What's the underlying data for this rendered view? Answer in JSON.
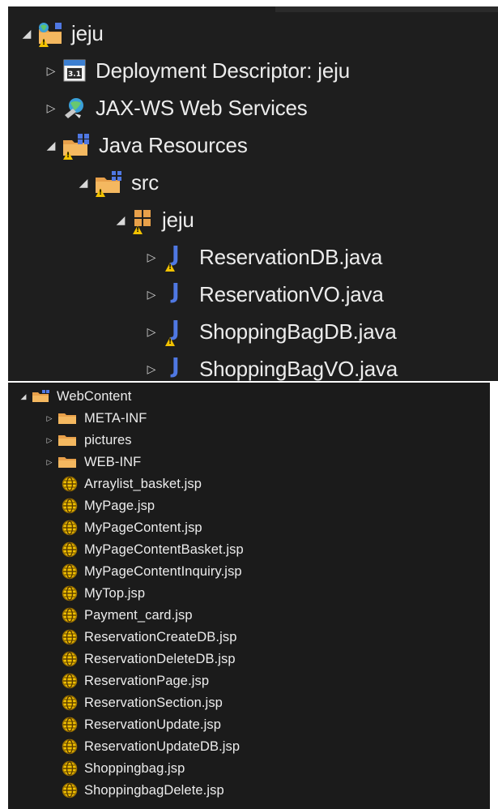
{
  "colors": {
    "background": "#1e1e1e",
    "text": "#ececec",
    "warning": "#f2c200",
    "java_blue": "#4f78e3",
    "folder_orange": "#e8a04a"
  },
  "tree_top": {
    "project": {
      "label": "jeju",
      "expanded": true,
      "icon": "web-project-warning-icon"
    },
    "deployment_descriptor": {
      "label": "Deployment Descriptor: jeju",
      "expanded": false,
      "icon": "deployment-descriptor-icon"
    },
    "jaxws": {
      "label": "JAX-WS Web Services",
      "expanded": false,
      "icon": "web-services-icon"
    },
    "java_resources": {
      "label": "Java Resources",
      "expanded": true,
      "icon": "java-resources-warning-icon"
    },
    "src": {
      "label": "src",
      "expanded": true,
      "icon": "source-folder-warning-icon"
    },
    "package": {
      "label": "jeju",
      "expanded": true,
      "icon": "package-warning-icon"
    },
    "files": [
      {
        "label": "ReservationDB.java",
        "warning": true
      },
      {
        "label": "ReservationVO.java",
        "warning": false
      },
      {
        "label": "ShoppingBagDB.java",
        "warning": true
      },
      {
        "label": "ShoppingBagVO.java",
        "warning": false
      }
    ]
  },
  "tree_bottom": {
    "webcontent": {
      "label": "WebContent",
      "expanded": true
    },
    "folders": [
      {
        "label": "META-INF"
      },
      {
        "label": "pictures"
      },
      {
        "label": "WEB-INF"
      }
    ],
    "jsp_files": [
      "Arraylist_basket.jsp",
      "MyPage.jsp",
      "MyPageContent.jsp",
      "MyPageContentBasket.jsp",
      "MyPageContentInquiry.jsp",
      "MyTop.jsp",
      "Payment_card.jsp",
      "ReservationCreateDB.jsp",
      "ReservationDeleteDB.jsp",
      "ReservationPage.jsp",
      "ReservationSection.jsp",
      "ReservationUpdate.jsp",
      "ReservationUpdateDB.jsp",
      "Shoppingbag.jsp",
      "ShoppingbagDelete.jsp"
    ]
  }
}
